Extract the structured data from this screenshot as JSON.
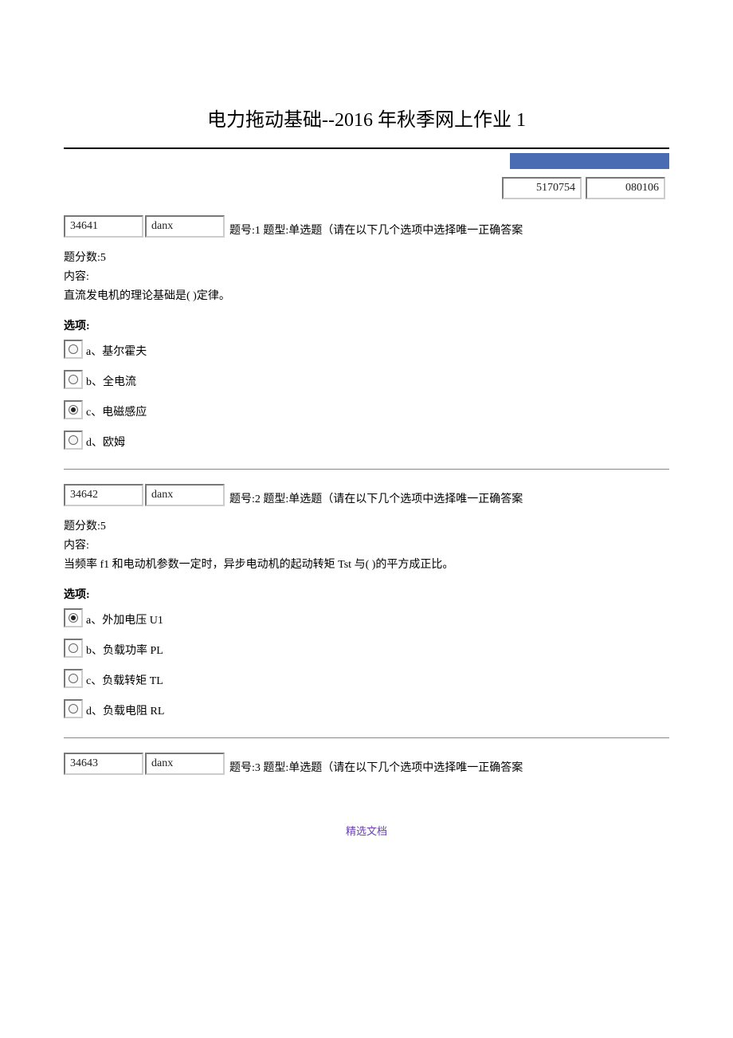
{
  "title": "电力拖动基础--2016 年秋季网上作业 1",
  "top_inputs": {
    "v1": "5170754",
    "v2": "080106"
  },
  "options_label": "选项:",
  "score_label": "题分数:5",
  "content_label": "内容:",
  "questions": [
    {
      "id": "34641",
      "type": "danx",
      "header": "题号:1  题型:单选题（请在以下几个选项中选择唯一正确答案",
      "content": "直流发电机的理论基础是( )定律。",
      "opts": [
        {
          "key": "a",
          "txt": "基尔霍夫",
          "checked": false
        },
        {
          "key": "b",
          "txt": "全电流",
          "checked": false
        },
        {
          "key": "c",
          "txt": "电磁感应",
          "checked": true
        },
        {
          "key": "d",
          "txt": "欧姆",
          "checked": false
        }
      ]
    },
    {
      "id": "34642",
      "type": "danx",
      "header": "题号:2  题型:单选题（请在以下几个选项中选择唯一正确答案",
      "content": "当频率 f1 和电动机参数一定时，异步电动机的起动转矩 Tst 与( )的平方成正比。",
      "opts": [
        {
          "key": "a",
          "txt": "外加电压 U1",
          "checked": true
        },
        {
          "key": "b",
          "txt": "负载功率 PL",
          "checked": false
        },
        {
          "key": "c",
          "txt": "负载转矩 TL",
          "checked": false
        },
        {
          "key": "d",
          "txt": "负载电阻 RL",
          "checked": false
        }
      ]
    },
    {
      "id": "34643",
      "type": "danx",
      "header": "题号:3  题型:单选题（请在以下几个选项中选择唯一正确答案",
      "content": "",
      "opts": []
    }
  ],
  "footer": "精选文档"
}
